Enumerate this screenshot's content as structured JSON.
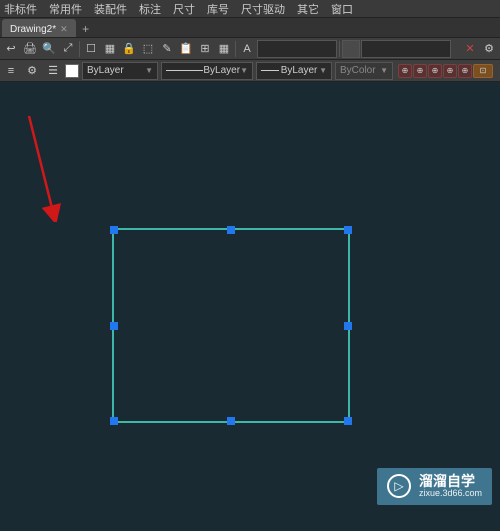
{
  "menubar": [
    "非标件",
    "常用件",
    "装配件",
    "标注",
    "尺寸",
    "库号",
    "尺寸驱动",
    "其它",
    "窗口"
  ],
  "tabs": {
    "active": {
      "label": "Drawing2*"
    },
    "add_symbol": "+"
  },
  "toolbar1": {
    "icons": [
      "↩",
      "🖨",
      "🔍",
      "⤢",
      "☐",
      "▦",
      "🔒",
      "⬚",
      "✎",
      "📋",
      "⊞",
      "▦"
    ],
    "text_a": "A",
    "pick_label": "",
    "end_glyph": "✕"
  },
  "toolbar2": {
    "layer_icons": [
      "≡",
      "⚙",
      "☰"
    ],
    "layers_dd": "ByLayer",
    "linetype_dd": "ByLayer",
    "lweight_dd": "ByLayer",
    "bycolor_dd": "ByColor",
    "status_glyph": "⊕",
    "last_glyph": "⊡"
  },
  "watermark": {
    "title": "溜溜自学",
    "url": "zixue.3d66.com",
    "play": "▷"
  },
  "colors": {
    "accent_rect": "#3db8a8",
    "grip": "#2277ee",
    "arrow": "#d01818"
  }
}
